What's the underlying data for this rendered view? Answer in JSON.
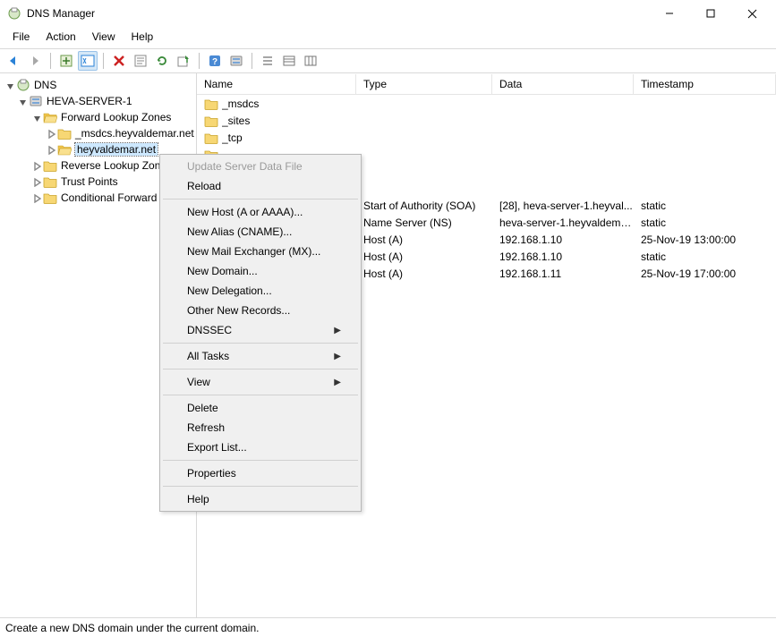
{
  "titlebar": {
    "title": "DNS Manager"
  },
  "menu": {
    "file": "File",
    "action": "Action",
    "view": "View",
    "help": "Help"
  },
  "tree": {
    "root": "DNS",
    "server": "HEVA-SERVER-1",
    "flz": "Forward Lookup Zones",
    "flz_child1": "_msdcs.heyvaldemar.net",
    "flz_child2": "heyvaldemar.net",
    "rlz": "Reverse Lookup Zon",
    "tp": "Trust Points",
    "cf": "Conditional Forward"
  },
  "columns": {
    "name": "Name",
    "type": "Type",
    "data": "Data",
    "timestamp": "Timestamp"
  },
  "rows": [
    {
      "icon": "folder",
      "name": "_msdcs",
      "type": "",
      "data": "",
      "timestamp": ""
    },
    {
      "icon": "folder",
      "name": "_sites",
      "type": "",
      "data": "",
      "timestamp": ""
    },
    {
      "icon": "folder",
      "name": "_tcp",
      "type": "",
      "data": "",
      "timestamp": ""
    },
    {
      "icon": "folder",
      "name": "",
      "type": "",
      "data": "",
      "timestamp": ""
    },
    {
      "icon": "blank",
      "name": "",
      "type": "",
      "data": "",
      "timestamp": ""
    },
    {
      "icon": "blank",
      "name": "",
      "type": "",
      "data": "",
      "timestamp": ""
    },
    {
      "icon": "record",
      "name": "",
      "type": "Start of Authority (SOA)",
      "data": "[28], heva-server-1.heyval...",
      "timestamp": "static"
    },
    {
      "icon": "record",
      "name": "",
      "type": "Name Server (NS)",
      "data": "heva-server-1.heyvaldema...",
      "timestamp": "static"
    },
    {
      "icon": "record",
      "name": "",
      "type": "Host (A)",
      "data": "192.168.1.10",
      "timestamp": "25-Nov-19 13:00:00"
    },
    {
      "icon": "record",
      "name": "",
      "type": "Host (A)",
      "data": "192.168.1.10",
      "timestamp": "static"
    },
    {
      "icon": "record",
      "name": "",
      "type": "Host (A)",
      "data": "192.168.1.11",
      "timestamp": "25-Nov-19 17:00:00"
    }
  ],
  "context_menu": [
    {
      "label": "Update Server Data File",
      "disabled": true
    },
    {
      "label": "Reload"
    },
    {
      "sep": true
    },
    {
      "label": "New Host (A or AAAA)..."
    },
    {
      "label": "New Alias (CNAME)..."
    },
    {
      "label": "New Mail Exchanger (MX)..."
    },
    {
      "label": "New Domain..."
    },
    {
      "label": "New Delegation..."
    },
    {
      "label": "Other New Records..."
    },
    {
      "label": "DNSSEC",
      "submenu": true
    },
    {
      "sep": true
    },
    {
      "label": "All Tasks",
      "submenu": true
    },
    {
      "sep": true
    },
    {
      "label": "View",
      "submenu": true
    },
    {
      "sep": true
    },
    {
      "label": "Delete"
    },
    {
      "label": "Refresh"
    },
    {
      "label": "Export List..."
    },
    {
      "sep": true
    },
    {
      "label": "Properties"
    },
    {
      "sep": true
    },
    {
      "label": "Help"
    }
  ],
  "statusbar": {
    "text": "Create a new DNS domain under the current domain."
  }
}
